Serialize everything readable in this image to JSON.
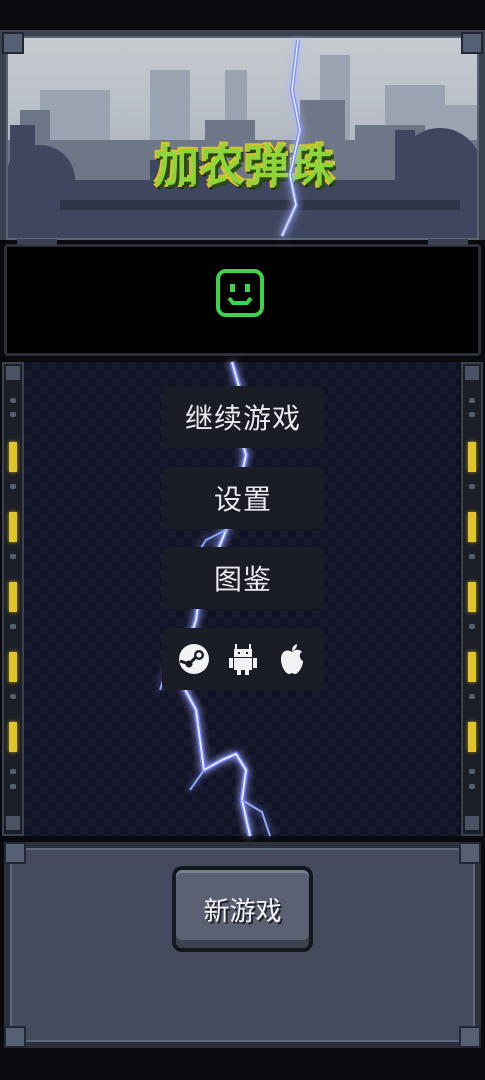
{
  "game": {
    "title": "加农弹珠"
  },
  "status": {
    "face_icon": "smiley-face-icon",
    "face_color": "#3fd24a"
  },
  "menu": {
    "continue_label": "继续游戏",
    "settings_label": "设置",
    "compendium_label": "图鉴"
  },
  "platforms": [
    {
      "icon": "steam-icon"
    },
    {
      "icon": "android-icon"
    },
    {
      "icon": "apple-icon"
    }
  ],
  "footer": {
    "new_game_label": "新游戏"
  },
  "colors": {
    "rail_light": "#e0c42a",
    "lightning": "#8ea2ff",
    "title_green": "#8fd43a"
  }
}
